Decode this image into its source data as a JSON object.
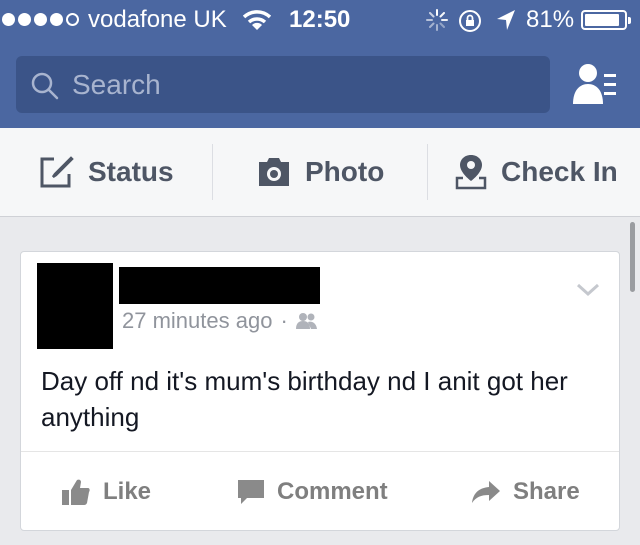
{
  "status_bar": {
    "carrier": "vodafone UK",
    "time": "12:50",
    "battery_percent": "81%",
    "battery_level": 0.81,
    "signal_bars": 4
  },
  "search": {
    "placeholder": "Search"
  },
  "actions": {
    "status": "Status",
    "photo": "Photo",
    "checkin": "Check In"
  },
  "post": {
    "timestamp": "27 minutes ago",
    "separator": "·",
    "text": "Day off nd it's mum's birthday nd I anit got her anything",
    "like": "Like",
    "comment": "Comment",
    "share": "Share"
  },
  "colors": {
    "brand": "#4b67a1",
    "search_bg": "#3b5488",
    "feed_bg": "#e9eaed",
    "action_text": "#4e5665",
    "muted": "#90949c"
  }
}
